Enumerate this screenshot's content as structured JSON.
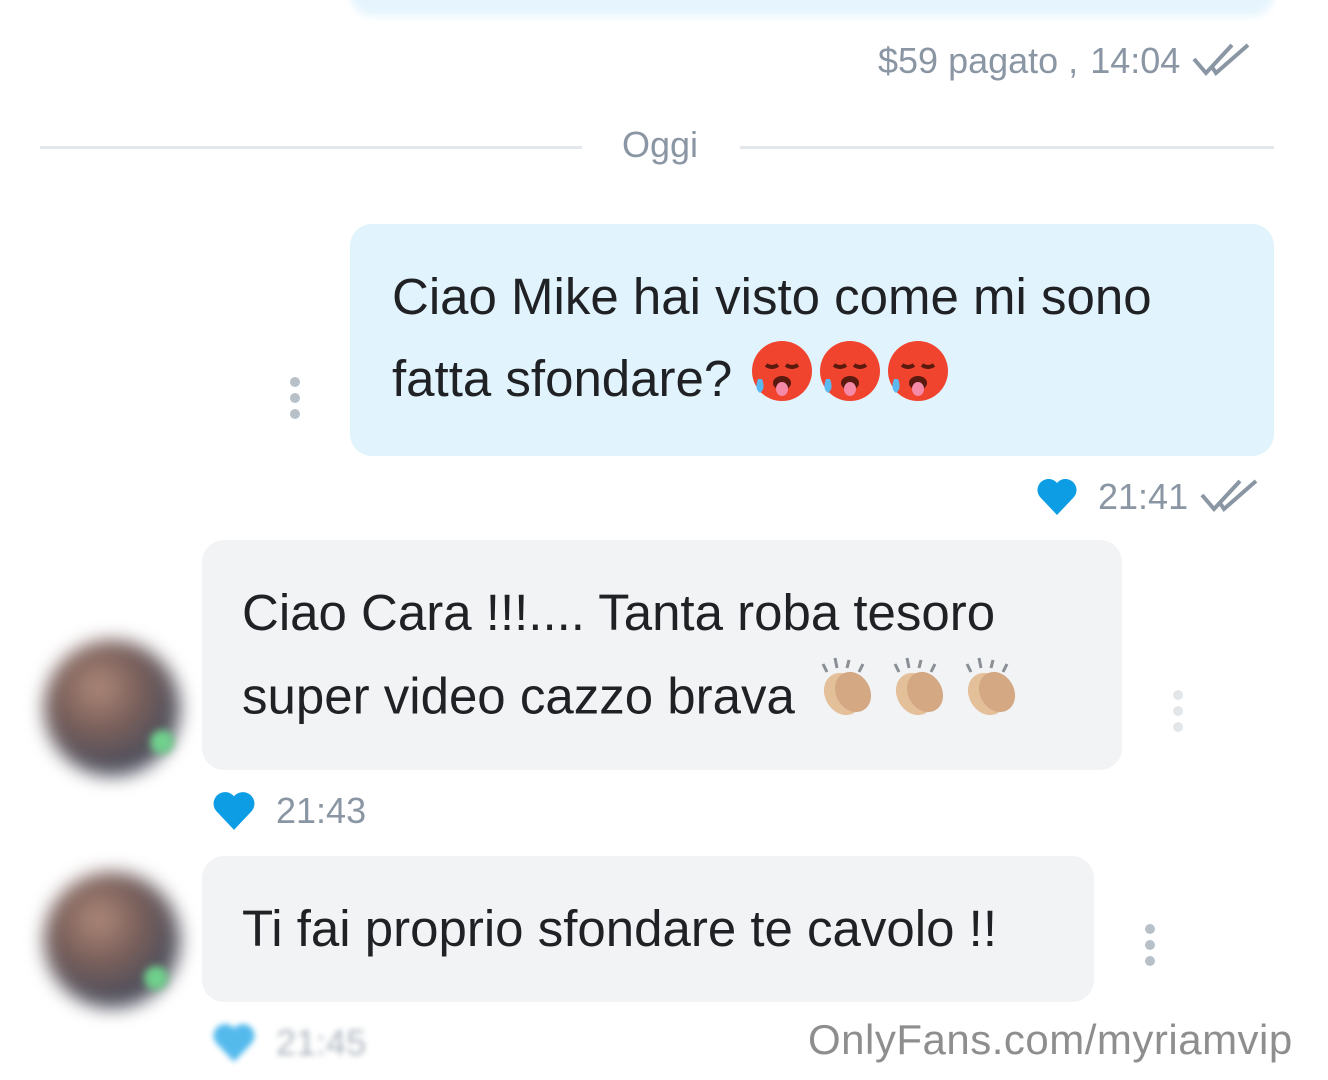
{
  "previous_message": {
    "price_label": "$59 pagato ,",
    "time": "14:04"
  },
  "date_divider": "Oggi",
  "messages": [
    {
      "side": "sent",
      "text": "Ciao Mike hai visto come mi sono fatta sfondare?",
      "emojis": [
        "hot-face",
        "hot-face",
        "hot-face"
      ],
      "time": "21:41",
      "liked": true,
      "read": true
    },
    {
      "side": "received",
      "text": "Ciao Cara !!!.... Tanta roba tesoro super video cazzo brava",
      "emojis": [
        "clapping-hands",
        "clapping-hands",
        "clapping-hands"
      ],
      "time": "21:43",
      "liked": true
    },
    {
      "side": "received",
      "text": "Ti fai proprio sfondare te cavolo !!",
      "time": "21:45",
      "liked": true
    }
  ],
  "watermark": "OnlyFans.com/myriamvip",
  "colors": {
    "accent": "#0c9de5",
    "sent_bubble": "#e1f3fc",
    "received_bubble": "#f2f3f5",
    "meta_text": "#8a96a3"
  }
}
